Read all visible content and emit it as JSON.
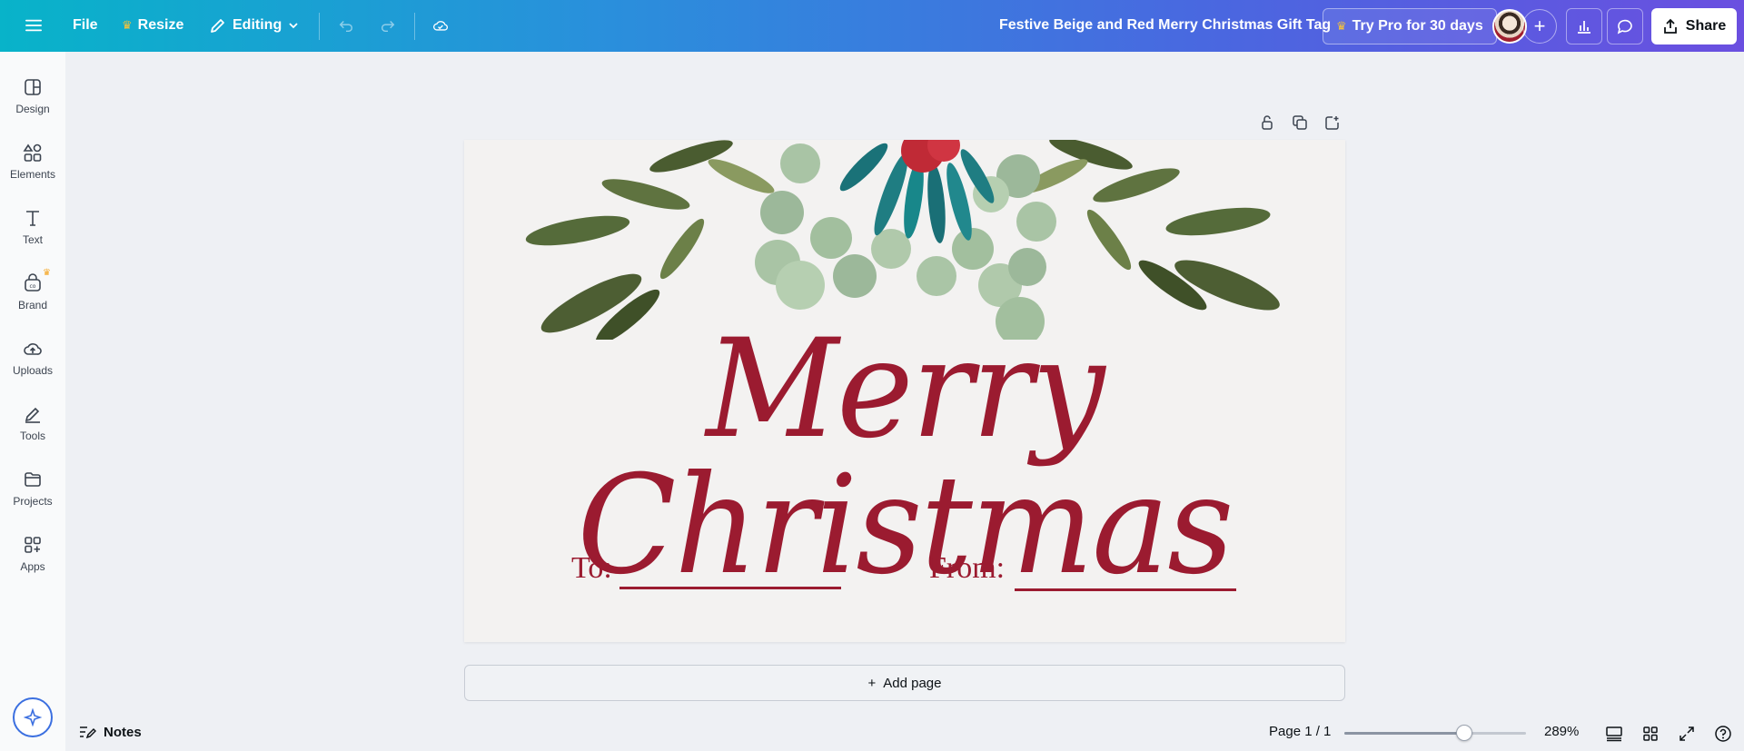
{
  "topbar": {
    "file_label": "File",
    "resize_label": "Resize",
    "editing_label": "Editing",
    "doc_title": "Festive Beige and Red Merry Christmas Gift Tag",
    "try_pro_label": "Try Pro for 30 days",
    "share_label": "Share",
    "add_collaborator_symbol": "+",
    "crown_icon": "crown-icon",
    "accent_gradient": [
      "#08b3c9",
      "#6a4fe0"
    ]
  },
  "sidebar": {
    "items": [
      {
        "label": "Design",
        "icon": "layout-icon"
      },
      {
        "label": "Elements",
        "icon": "shapes-icon"
      },
      {
        "label": "Text",
        "icon": "text-icon"
      },
      {
        "label": "Brand",
        "icon": "brand-icon"
      },
      {
        "label": "Uploads",
        "icon": "cloud-upload-icon"
      },
      {
        "label": "Tools",
        "icon": "pen-tool-icon"
      },
      {
        "label": "Projects",
        "icon": "folder-icon"
      },
      {
        "label": "Apps",
        "icon": "apps-icon"
      }
    ]
  },
  "canvas": {
    "title_text": "Merry Christmas",
    "to_label": "To:",
    "from_label": "From:",
    "brand_color": "#9b1b30",
    "page_background": "#f3f2f1",
    "add_page_label": "Add page",
    "add_page_symbol": "+"
  },
  "bottombar": {
    "notes_label": "Notes",
    "page_indicator": "Page 1 / 1",
    "zoom_label": "289%",
    "zoom_fraction": 0.66
  }
}
